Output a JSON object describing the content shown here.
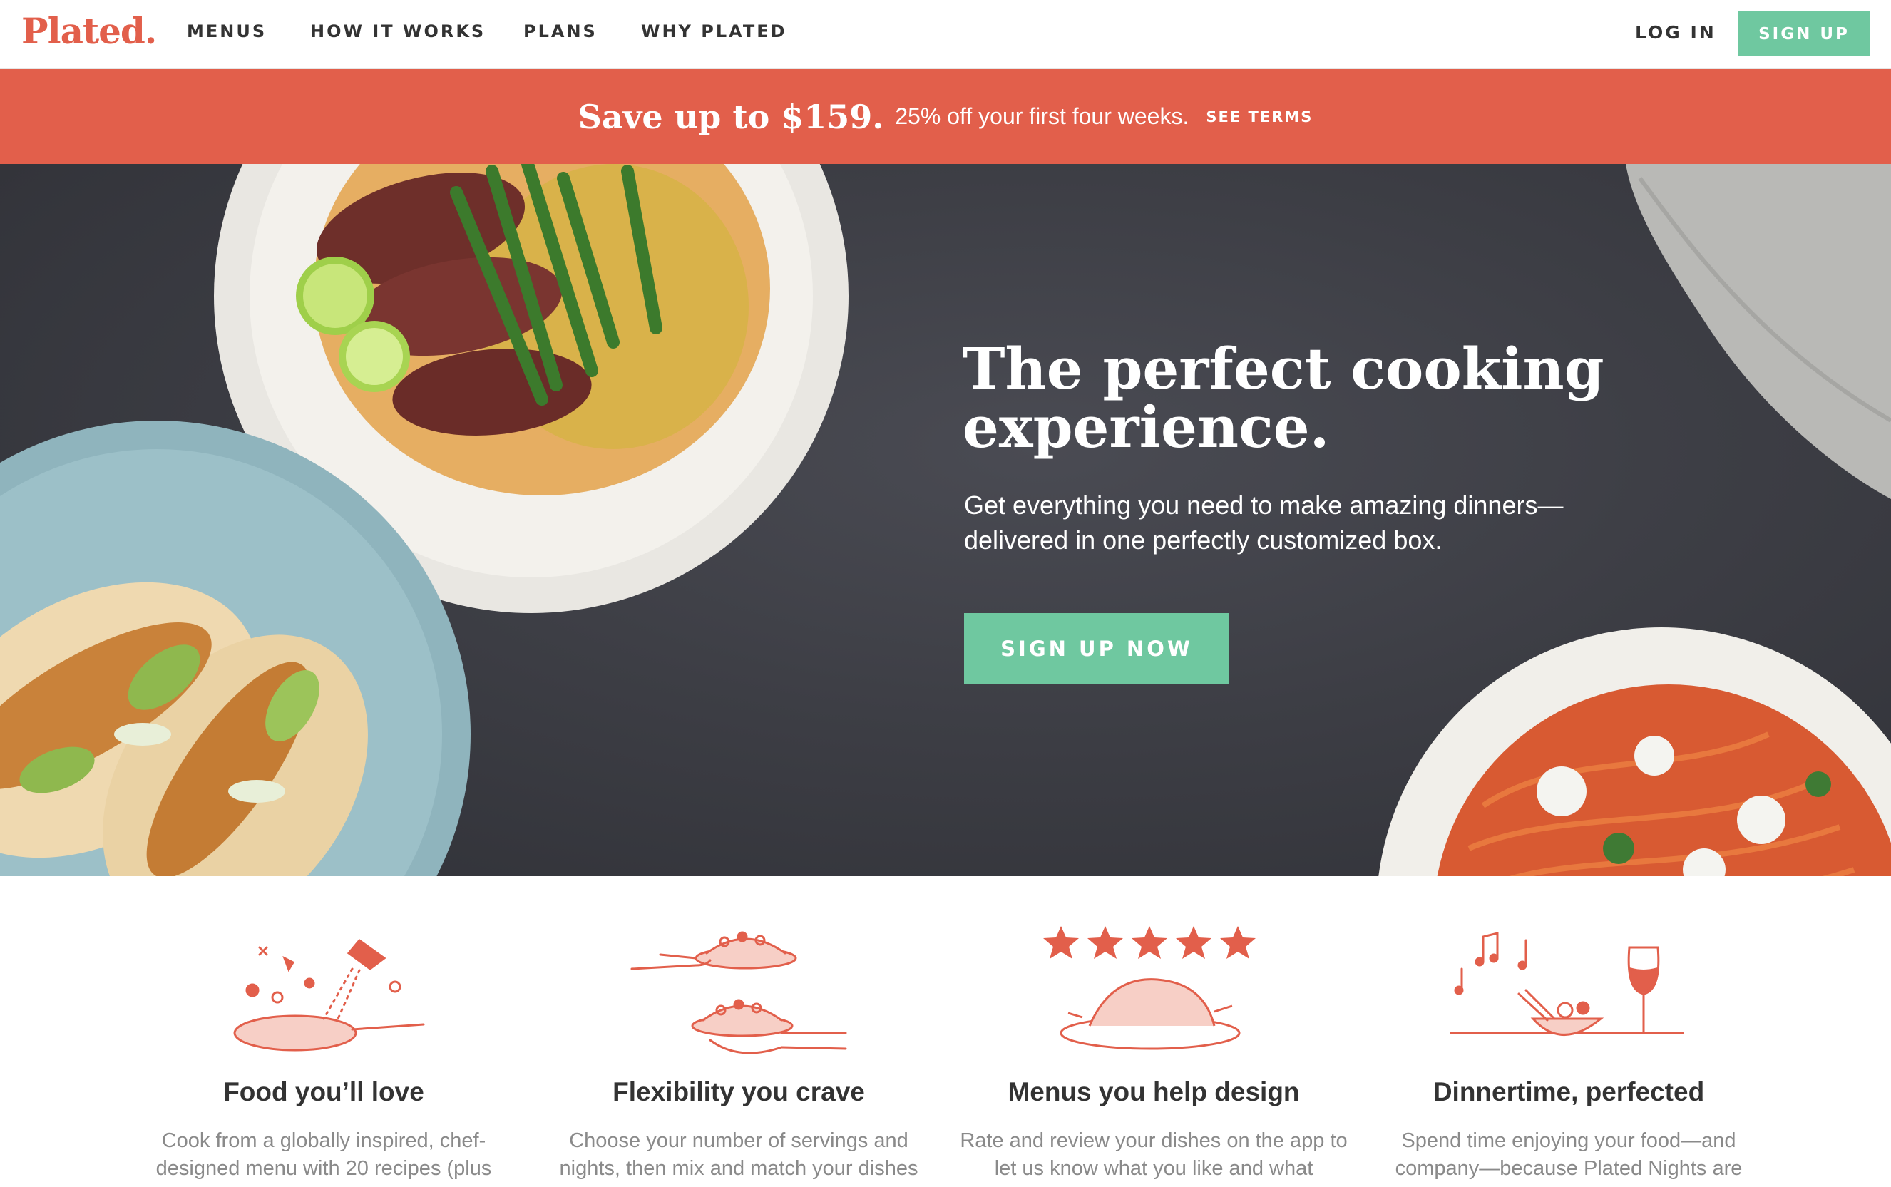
{
  "nav": {
    "logo": "Plated.",
    "links": [
      "MENUS",
      "HOW IT WORKS",
      "PLANS",
      "WHY PLATED"
    ],
    "login": "LOG IN",
    "signup": "SIGN UP"
  },
  "promo": {
    "headline": "Save up to $159.",
    "subtext": "25% off your first four weeks.",
    "terms": "SEE TERMS"
  },
  "hero": {
    "title": "The perfect cooking experience.",
    "subtitle": "Get everything you need to make amazing dinners—delivered in one perfectly customized box.",
    "cta": "SIGN UP NOW"
  },
  "features": [
    {
      "icon": "cooking-pan-icon",
      "title": "Food you’ll love",
      "body": "Cook from a globally inspired, chef-designed menu with 20 recipes (plus"
    },
    {
      "icon": "serving-dishes-icon",
      "title": "Flexibility you crave",
      "body": "Choose your number of servings and nights, then mix and match your dishes"
    },
    {
      "icon": "five-stars-icon",
      "title": "Menus you help design",
      "body": "Rate and review your dishes on the app to let us know what you like and what"
    },
    {
      "icon": "dinner-wine-icon",
      "title": "Dinnertime, perfected",
      "body": "Spend time enjoying your food—and company—because Plated Nights are"
    }
  ],
  "colors": {
    "brand": "#e25f4b",
    "accent": "#6fc8a0",
    "hero_bg": "#3d3e45"
  }
}
